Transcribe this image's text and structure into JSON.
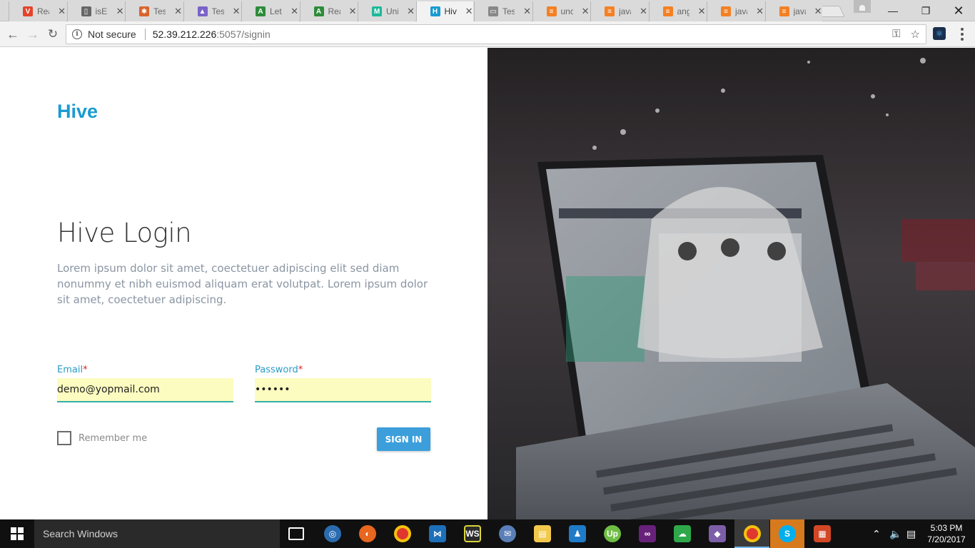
{
  "browser": {
    "tabs": [
      {
        "title": "Rea",
        "icon": "vivaldi-v-icon",
        "color": "#e5432b",
        "glyph": "V"
      },
      {
        "title": "isEm",
        "icon": "book-icon",
        "color": "#666666",
        "glyph": "▯"
      },
      {
        "title": "Test",
        "icon": "puzzle-icon",
        "color": "#d9642b",
        "glyph": "✱"
      },
      {
        "title": "Test",
        "icon": "mountain-icon",
        "color": "#7a63c9",
        "glyph": "▲"
      },
      {
        "title": "Let'",
        "icon": "green-a-icon",
        "color": "#2e8b3a",
        "glyph": "A"
      },
      {
        "title": "Rea",
        "icon": "green-a-icon",
        "color": "#2e8b3a",
        "glyph": "A"
      },
      {
        "title": "Unit",
        "icon": "m-logo-icon",
        "color": "#1fb89a",
        "glyph": "M"
      },
      {
        "title": "Hive",
        "icon": "h-logo-icon",
        "color": "#1a9bd0",
        "glyph": "H",
        "active": true
      },
      {
        "title": "Test",
        "icon": "document-icon",
        "color": "#888888",
        "glyph": "▭"
      },
      {
        "title": "unc",
        "icon": "stackoverflow-icon",
        "color": "#f48024",
        "glyph": "≡"
      },
      {
        "title": "java",
        "icon": "stackoverflow-icon",
        "color": "#f48024",
        "glyph": "≡"
      },
      {
        "title": "ang",
        "icon": "stackoverflow-icon",
        "color": "#f48024",
        "glyph": "≡"
      },
      {
        "title": "java",
        "icon": "stackoverflow-icon",
        "color": "#f48024",
        "glyph": "≡"
      },
      {
        "title": "java",
        "icon": "stackoverflow-icon",
        "color": "#f48024",
        "glyph": "≡"
      }
    ],
    "security_label": "Not secure",
    "url_host": "52.39.212.226",
    "url_path": ":5057/signin"
  },
  "page": {
    "logo": "Hive",
    "title": "Hive Login",
    "description": "Lorem ipsum dolor sit amet, coectetuer adipiscing elit sed diam nonummy et nibh euismod aliquam erat volutpat. Lorem ipsum dolor sit amet, coectetuer adipiscing.",
    "email_label": "Email",
    "email_value": "demo@yopmail.com",
    "password_label": "Password",
    "password_value": "••••••",
    "required_mark": "*",
    "remember_label": "Remember me",
    "signin_label": "SIGN IN",
    "accent_color": "#1a9bd0"
  },
  "taskbar": {
    "search_placeholder": "Search Windows",
    "time": "5:03 PM",
    "date": "7/20/2017"
  }
}
